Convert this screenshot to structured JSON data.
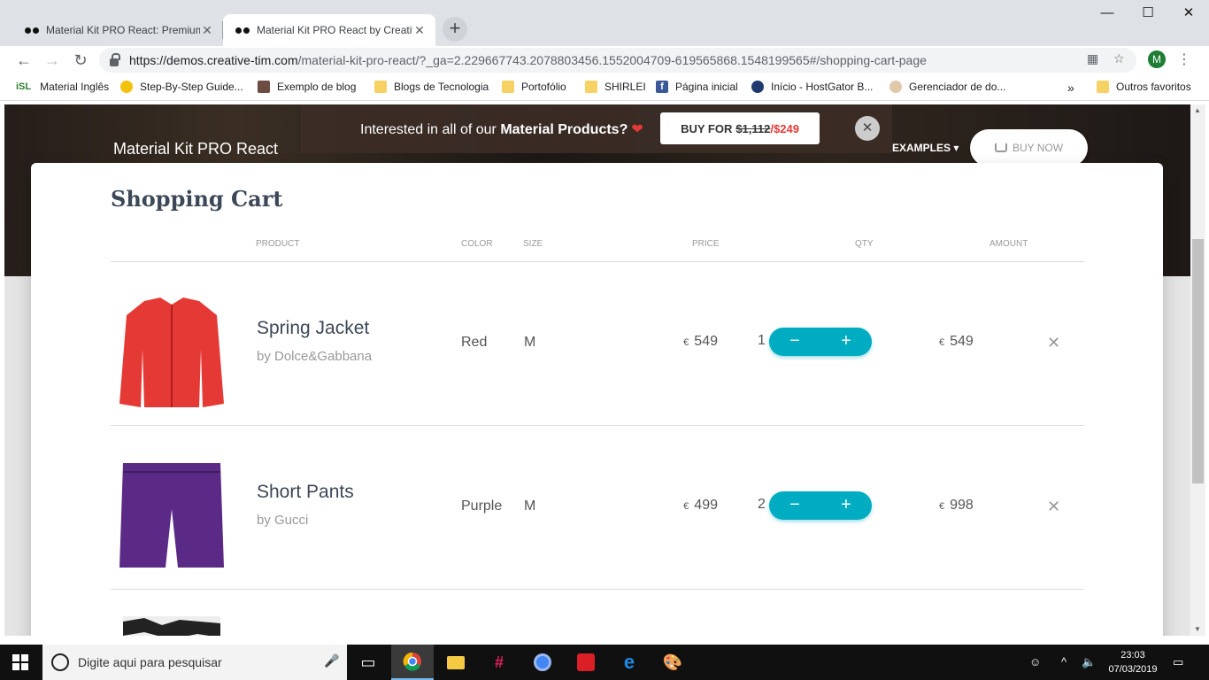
{
  "browser": {
    "tabs": [
      {
        "title": "Material Kit PRO React: Premium",
        "active": false
      },
      {
        "title": "Material Kit PRO React by Creativ",
        "active": true
      }
    ],
    "url_host": "https://demos.creative-tim.com",
    "url_path": "/material-kit-pro-react/?_ga=2.229667743.2078803456.1552004709-619565868.1548199565#/shopping-cart-page",
    "profile_initial": "M",
    "bookmarks": [
      "Material Inglês",
      "Step-By-Step Guide...",
      "Exemplo de blog",
      "Blogs de Tecnologia",
      "Portofólio",
      "SHIRLEI",
      "Página inicial",
      "Início - HostGator B...",
      "Gerenciador de do...",
      "Outros favoritos"
    ],
    "bookmark_logo_text": "iSL"
  },
  "page": {
    "brand": "Material Kit PRO React",
    "nav_examples": "EXAMPLES",
    "buy_now": "BUY NOW",
    "promo": {
      "text_pre": "Interested in all of our ",
      "text_bold": "Material Products?",
      "button_label": "BUY FOR ",
      "old_price": "$1,112",
      "separator": "/",
      "new_price": "$249"
    },
    "cart_title": "Shopping Cart",
    "columns": {
      "product": "PRODUCT",
      "color": "COLOR",
      "size": "SIZE",
      "price": "PRICE",
      "qty": "QTY",
      "amount": "AMOUNT"
    },
    "currency": "€",
    "items": [
      {
        "name": "Spring Jacket",
        "brand": "by Dolce&Gabbana",
        "color": "Red",
        "size": "M",
        "price": "549",
        "qty": "1",
        "amount": "549",
        "image_color": "#e53935"
      },
      {
        "name": "Short Pants",
        "brand": "by Gucci",
        "color": "Purple",
        "size": "M",
        "price": "499",
        "qty": "2",
        "amount": "998",
        "image_color": "#5b2a86"
      }
    ],
    "accent_color": "#00acc1"
  },
  "taskbar": {
    "search_placeholder": "Digite aqui para pesquisar",
    "time": "23:03",
    "date": "07/03/2019"
  }
}
